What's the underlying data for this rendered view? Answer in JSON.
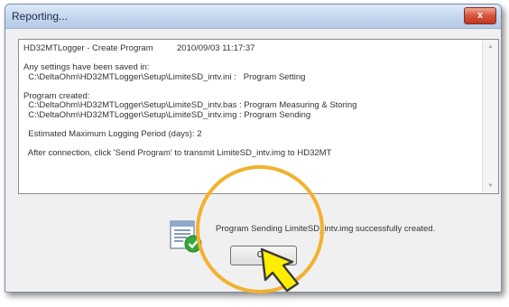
{
  "dialog": {
    "title": "Reporting...",
    "close_label": "x"
  },
  "log": {
    "lines": [
      "HD32MTLogger - Create Program          2010/09/03 11:17:37",
      "",
      "Any settings have been saved in:",
      "  C:\\DeltaOhm\\HD32MTLogger\\Setup\\LimiteSD_intv.ini :   Program Setting",
      "",
      "Program created:",
      "  C:\\DeltaOhm\\HD32MTLogger\\Setup\\LimiteSD_intv.bas : Program Measuring & Storing",
      "  C:\\DeltaOhm\\HD32MTLogger\\Setup\\LimiteSD_intv.img : Program Sending",
      "",
      "  Estimated Maximum Logging Period (days): 2",
      "",
      "  After connection, click 'Send Program' to transmit LimiteSD_intv.img to HD32MT"
    ]
  },
  "status": {
    "message": "Program Sending LimiteSD_intv.img successfully created.",
    "icon": "document-check-icon"
  },
  "buttons": {
    "ok_label": "OK"
  },
  "overlay": {
    "highlight_color": "#f2b12e",
    "cursor_color": "#ffee00"
  }
}
